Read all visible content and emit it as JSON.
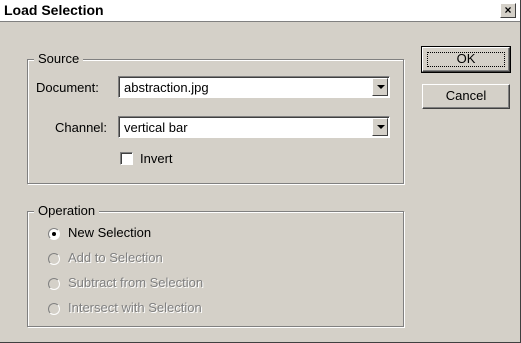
{
  "window": {
    "title": "Load Selection",
    "close_glyph": "×"
  },
  "source": {
    "legend": "Source",
    "document_label": "Document:",
    "document_value": "abstraction.jpg",
    "channel_label": "Channel:",
    "channel_value": "vertical bar",
    "invert_label": "Invert",
    "invert_checked": false
  },
  "operation": {
    "legend": "Operation",
    "options": [
      {
        "label": "New Selection",
        "selected": true,
        "enabled": true
      },
      {
        "label": "Add to Selection",
        "selected": false,
        "enabled": false
      },
      {
        "label": "Subtract from Selection",
        "selected": false,
        "enabled": false
      },
      {
        "label": "Intersect with Selection",
        "selected": false,
        "enabled": false
      }
    ]
  },
  "buttons": {
    "ok": "OK",
    "cancel": "Cancel"
  },
  "icons": {
    "dropdown": "chevron-down-icon",
    "close": "close-icon",
    "radio": "radio-dot-icon"
  }
}
